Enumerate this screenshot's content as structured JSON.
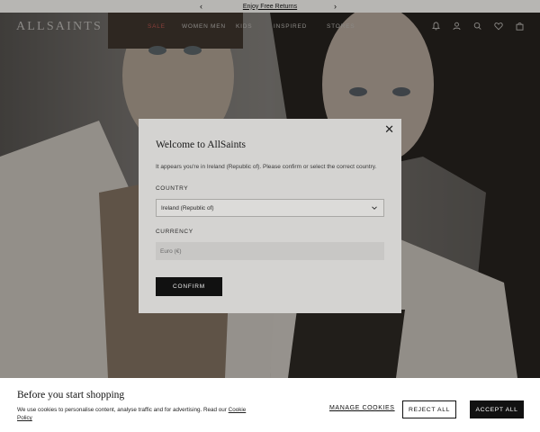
{
  "promo": {
    "text": "Enjoy Free Returns",
    "prev_icon": "chevron-left-icon",
    "next_icon": "chevron-right-icon"
  },
  "nav": {
    "logo": "ALLSAINTS",
    "links": [
      "SALE",
      "WOMEN",
      "MEN",
      "KIDS",
      "INSPIRED",
      "STORES"
    ],
    "sale_color": "#8a3f3a",
    "icons": [
      "bell-icon",
      "account-icon",
      "search-icon",
      "wishlist-icon",
      "bag-icon"
    ]
  },
  "modal": {
    "title": "Welcome to AllSaints",
    "description": "It appears you're in Ireland (Republic of). Please confirm or select the correct country.",
    "country_label": "COUNTRY",
    "country_value": "Ireland (Republic of)",
    "currency_label": "CURRENCY",
    "currency_value": "Euro (€)",
    "confirm_label": "CONFIRM",
    "close_icon": "close-icon"
  },
  "cookie": {
    "title": "Before you start shopping",
    "text": "We use cookies to personalise content, analyse traffic and for advertising. Read our",
    "link": "Cookie Policy",
    "manage_label": "MANAGE COOKIES",
    "reject_label": "REJECT ALL",
    "accept_label": "ACCEPT ALL"
  }
}
